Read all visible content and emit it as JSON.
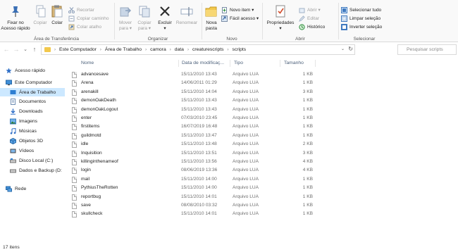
{
  "ribbon": {
    "clipboard": {
      "group_label": "Área de Transferência",
      "pin_label_1": "Fixar no",
      "pin_label_2": "Acesso rápido",
      "copy_label": "Copiar",
      "paste_label": "Colar",
      "cut_label": "Recortar",
      "copy_path_label": "Copiar caminho",
      "paste_shortcut_label": "Colar atalho"
    },
    "organize": {
      "group_label": "Organizar",
      "move_label_1": "Mover",
      "move_label_2": "para ▾",
      "copy_to_label_1": "Copiar",
      "copy_to_label_2": "para ▾",
      "delete_label_1": "Excluir",
      "delete_label_2": "▾",
      "rename_label": "Renomear"
    },
    "new": {
      "group_label": "Novo",
      "new_folder_label_1": "Nova",
      "new_folder_label_2": "pasta",
      "new_item_label": "Novo item ▾",
      "easy_access_label": "Fácil acesso ▾"
    },
    "open": {
      "group_label": "Abrir",
      "properties_label_1": "Propriedades",
      "properties_label_2": "▾",
      "open_label": "Abrir ▾",
      "edit_label": "Editar",
      "history_label": "Histórico"
    },
    "select": {
      "group_label": "Selecionar",
      "select_all_label": "Selecionar tudo",
      "clear_selection_label": "Limpar seleção",
      "invert_selection_label": "Inverter seleção"
    }
  },
  "address": {
    "back": "←",
    "forward": "→",
    "recent": "⌄",
    "up": "↑",
    "crumbs": [
      "Este Computador",
      "Área de Trabalho",
      "camora",
      "data",
      "creaturescripts",
      "scripts"
    ],
    "crumb_sep": "›",
    "search_placeholder": "Pesquisar scripts"
  },
  "nav": {
    "quick_access": "Acesso rápido",
    "this_pc": "Este Computador",
    "items": [
      {
        "label": "Área de Trabalho",
        "icon": "desktop-icon",
        "selected": true
      },
      {
        "label": "Documentos",
        "icon": "documents-icon"
      },
      {
        "label": "Downloads",
        "icon": "downloads-icon"
      },
      {
        "label": "Imagens",
        "icon": "pictures-icon"
      },
      {
        "label": "Músicas",
        "icon": "music-icon"
      },
      {
        "label": "Objetos 3D",
        "icon": "objects-3d-icon"
      },
      {
        "label": "Vídeos",
        "icon": "videos-icon"
      },
      {
        "label": "Disco Local (C:)",
        "icon": "drive-icon"
      },
      {
        "label": "Dados e Backup (D:",
        "icon": "drive-icon"
      }
    ],
    "network": "Rede"
  },
  "columns": {
    "name": "Nome",
    "date": "Data de modificaç...",
    "type": "Tipo",
    "size": "Tamanho"
  },
  "files": [
    {
      "name": "advancesave",
      "date": "15/11/2010 13:43",
      "type": "Arquivo LUA",
      "size": "1 KB"
    },
    {
      "name": "Arena",
      "date": "14/06/2011 01:29",
      "type": "Arquivo LUA",
      "size": "1 KB"
    },
    {
      "name": "arenakill",
      "date": "15/11/2010 14:04",
      "type": "Arquivo LUA",
      "size": "3 KB"
    },
    {
      "name": "demonOakDeath",
      "date": "15/11/2010 13:43",
      "type": "Arquivo LUA",
      "size": "1 KB"
    },
    {
      "name": "demonOakLogout",
      "date": "15/11/2010 13:43",
      "type": "Arquivo LUA",
      "size": "1 KB"
    },
    {
      "name": "enter",
      "date": "07/03/2010 23:45",
      "type": "Arquivo LUA",
      "size": "1 KB"
    },
    {
      "name": "firstitems",
      "date": "16/07/2019 16:48",
      "type": "Arquivo LUA",
      "size": "1 KB"
    },
    {
      "name": "guildmotd",
      "date": "15/11/2010 13:47",
      "type": "Arquivo LUA",
      "size": "1 KB"
    },
    {
      "name": "idle",
      "date": "15/11/2010 13:48",
      "type": "Arquivo LUA",
      "size": "2 KB"
    },
    {
      "name": "Inquisition",
      "date": "15/11/2010 13:51",
      "type": "Arquivo LUA",
      "size": "3 KB"
    },
    {
      "name": "killinginthenameof",
      "date": "15/11/2010 13:56",
      "type": "Arquivo LUA",
      "size": "4 KB"
    },
    {
      "name": "login",
      "date": "08/06/2019 13:36",
      "type": "Arquivo LUA",
      "size": "4 KB"
    },
    {
      "name": "mail",
      "date": "15/11/2010 14:00",
      "type": "Arquivo LUA",
      "size": "1 KB"
    },
    {
      "name": "PythiusTheRotten",
      "date": "15/11/2010 14:00",
      "type": "Arquivo LUA",
      "size": "1 KB"
    },
    {
      "name": "reportbug",
      "date": "15/11/2010 14:01",
      "type": "Arquivo LUA",
      "size": "1 KB"
    },
    {
      "name": "save",
      "date": "08/08/2010 03:32",
      "type": "Arquivo LUA",
      "size": "1 KB"
    },
    {
      "name": "skullcheck",
      "date": "15/11/2010 14:01",
      "type": "Arquivo LUA",
      "size": "1 KB"
    }
  ],
  "status": {
    "count_text": "17 itens"
  },
  "colors": {
    "selection": "#cce8ff",
    "folder": "#f2c84c",
    "accent": "#0a64c8"
  }
}
